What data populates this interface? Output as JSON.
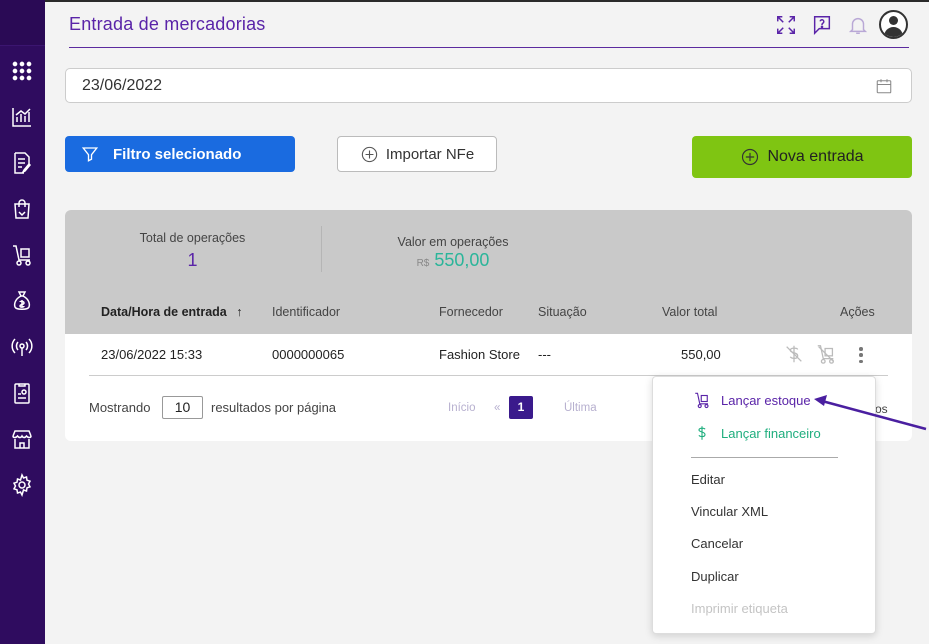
{
  "header": {
    "title": "Entrada de mercadorias",
    "icons": [
      "fullscreen-icon",
      "help-chat-icon",
      "bell-icon",
      "user-avatar-icon"
    ]
  },
  "sidebar": {
    "items": [
      "apps-grid-icon",
      "chart-icon",
      "document-edit-icon",
      "shopping-bag-icon",
      "hand-truck-icon",
      "money-bag-icon",
      "broadcast-icon",
      "report-icon",
      "store-icon",
      "settings-gear-icon"
    ]
  },
  "date_filter": {
    "value": "23/06/2022"
  },
  "toolbar": {
    "filter_label": "Filtro selecionado",
    "import_label": "Importar NFe",
    "new_label": "Nova entrada"
  },
  "summary": {
    "total_ops_label": "Total de operações",
    "total_ops_value": "1",
    "total_value_label": "Valor em operações",
    "currency": "R$",
    "total_value": "550,00"
  },
  "table": {
    "headers": {
      "date": "Data/Hora de entrada",
      "id": "Identificador",
      "supplier": "Fornecedor",
      "status": "Situação",
      "total": "Valor total",
      "actions": "Ações"
    },
    "rows": [
      {
        "date": "23/06/2022 15:33",
        "id": "0000000065",
        "supplier": "Fashion Store",
        "status": "---",
        "total": "550,00"
      }
    ]
  },
  "pagination": {
    "showing_label": "Mostrando",
    "per_page": "10",
    "per_page_suffix": "resultados por página",
    "first": "Início",
    "prev": "«",
    "current": "1",
    "last": "Última",
    "right_fragment": "os"
  },
  "context_menu": {
    "launch_stock": "Lançar estoque",
    "launch_finance": "Lançar financeiro",
    "edit": "Editar",
    "link_xml": "Vincular XML",
    "cancel": "Cancelar",
    "duplicate": "Duplicar",
    "print_label": "Imprimir etiqueta"
  },
  "colors": {
    "sidebar": "#2f0c5f",
    "accent_purple": "#5a24a8",
    "primary_blue": "#1a6be0",
    "success_green": "#7fc512",
    "teal_value": "#2bb59a",
    "finance_green": "#1fae7e"
  }
}
